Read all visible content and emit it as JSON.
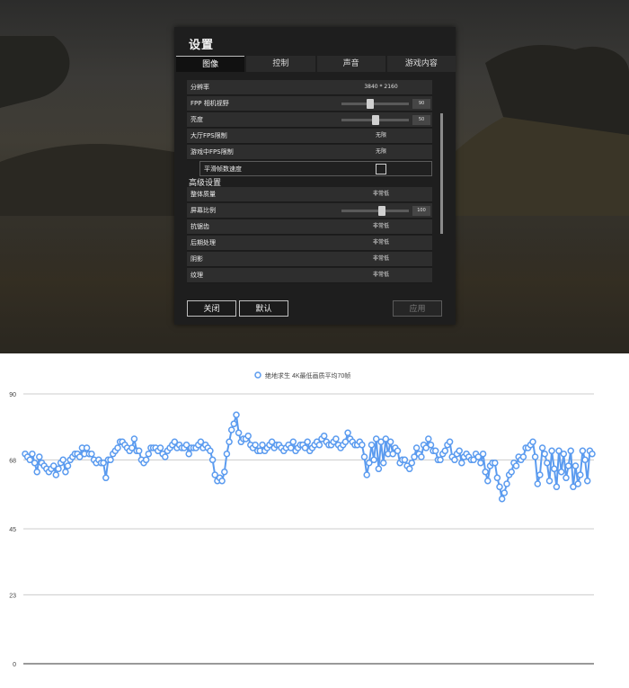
{
  "settings": {
    "title": "设置",
    "tabs": [
      "图像",
      "控制",
      "声音",
      "游戏内容"
    ],
    "active_tab": "图像",
    "rows": {
      "resolution": {
        "label": "分辨率",
        "value": "3840 * 2160"
      },
      "fpp_fov": {
        "label": "FPP 相机视野",
        "value": "90",
        "level": 0.43
      },
      "brightness": {
        "label": "亮度",
        "value": "50",
        "level": 0.5
      },
      "lobby_fps": {
        "label": "大厅FPS限制",
        "value": "无限"
      },
      "ingame_fps": {
        "label": "游戏中FPS限制",
        "value": "无限"
      },
      "smooth_fps": {
        "label": "平滑帧数速度",
        "checked": false
      }
    },
    "advanced_section": "高级设置",
    "advanced": {
      "overall_quality": {
        "label": "整体质量",
        "value": "非常低"
      },
      "screen_scale": {
        "label": "屏幕比例",
        "value": "100",
        "level": 0.6
      },
      "anti_aliasing": {
        "label": "抗锯齿",
        "value": "非常低"
      },
      "post_processing": {
        "label": "后期处理",
        "value": "非常低"
      },
      "shadows": {
        "label": "阴影",
        "value": "非常低"
      },
      "textures": {
        "label": "纹理",
        "value": "非常低"
      }
    },
    "buttons": {
      "close": "关闭",
      "default": "默认",
      "apply": "应用"
    }
  },
  "chart_data": {
    "type": "line",
    "title": "",
    "xlabel": "",
    "ylabel": "",
    "ylim": [
      0,
      90
    ],
    "yticks": [
      0,
      23,
      45,
      68,
      90
    ],
    "legend": "top",
    "grid": true,
    "series": [
      {
        "name": "绝地求生 4K最低画质平均70帧",
        "color": "#5b9bef",
        "values": [
          70,
          69,
          68,
          70,
          67,
          64,
          69,
          67,
          66,
          65,
          64,
          65,
          66,
          63,
          65,
          67,
          68,
          64,
          66,
          68,
          69,
          70,
          70,
          69,
          72,
          70,
          72,
          70,
          70,
          68,
          67,
          68,
          67,
          67,
          62,
          68,
          68,
          70,
          71,
          72,
          74,
          74,
          73,
          72,
          71,
          72,
          75,
          71,
          71,
          68,
          67,
          68,
          70,
          72,
          72,
          72,
          71,
          72,
          70,
          69,
          71,
          72,
          73,
          74,
          72,
          73,
          72,
          72,
          73,
          70,
          72,
          72,
          72,
          73,
          74,
          72,
          73,
          72,
          71,
          68,
          63,
          61,
          62,
          61,
          64,
          70,
          74,
          78,
          80,
          83,
          77,
          74,
          75,
          75,
          76,
          73,
          72,
          73,
          71,
          71,
          73,
          71,
          72,
          73,
          74,
          72,
          73,
          73,
          72,
          71,
          72,
          73,
          72,
          74,
          71,
          72,
          73,
          73,
          72,
          74,
          71,
          72,
          73,
          74,
          73,
          75,
          76,
          74,
          73,
          73,
          74,
          75,
          73,
          72,
          73,
          74,
          77,
          75,
          74,
          73,
          73,
          74,
          73,
          69,
          63,
          67,
          73,
          68,
          75,
          65,
          74,
          67,
          75,
          70,
          74,
          70,
          72,
          71,
          67,
          68,
          68,
          66,
          65,
          67,
          69,
          72,
          70,
          69,
          73,
          72,
          75,
          73,
          71,
          71,
          68,
          68,
          70,
          71,
          73,
          74,
          69,
          68,
          70,
          71,
          67,
          69,
          70,
          69,
          68,
          68,
          70,
          69,
          67,
          70,
          64,
          61,
          66,
          67,
          67,
          62,
          59,
          55,
          57,
          60,
          63,
          64,
          67,
          66,
          69,
          68,
          69,
          72,
          72,
          73,
          74,
          69,
          60,
          63,
          72,
          70,
          67,
          61,
          71,
          65,
          59,
          71,
          64,
          70,
          62,
          66,
          71,
          59,
          66,
          60,
          63,
          71,
          68,
          61,
          71,
          70
        ]
      }
    ]
  }
}
